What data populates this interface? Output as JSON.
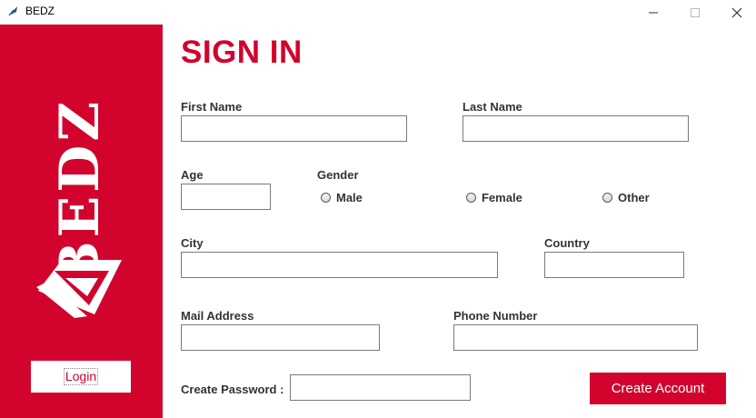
{
  "window": {
    "title": "BEDZ",
    "icon": "feather-icon",
    "controls": [
      "minimize-icon",
      "maximize-icon",
      "close-icon"
    ]
  },
  "sidebar": {
    "logo_text": "BEDZ",
    "logo_mark": "triangle-logo",
    "login_label": "Login",
    "color": "#d2042d"
  },
  "form": {
    "heading": "SIGN IN",
    "first_name": {
      "label": "First Name",
      "value": ""
    },
    "last_name": {
      "label": "Last Name",
      "value": ""
    },
    "age": {
      "label": "Age",
      "value": ""
    },
    "gender": {
      "label": "Gender",
      "options": [
        "Male",
        "Female",
        "Other"
      ],
      "selected": null
    },
    "city": {
      "label": "City",
      "value": ""
    },
    "country": {
      "label": "Country",
      "value": ""
    },
    "mail": {
      "label": "Mail Address",
      "value": ""
    },
    "phone": {
      "label": "Phone Number",
      "value": ""
    },
    "password": {
      "label": "Create Password :",
      "value": ""
    },
    "create_label": "Create Account",
    "accent": "#d2042d"
  }
}
